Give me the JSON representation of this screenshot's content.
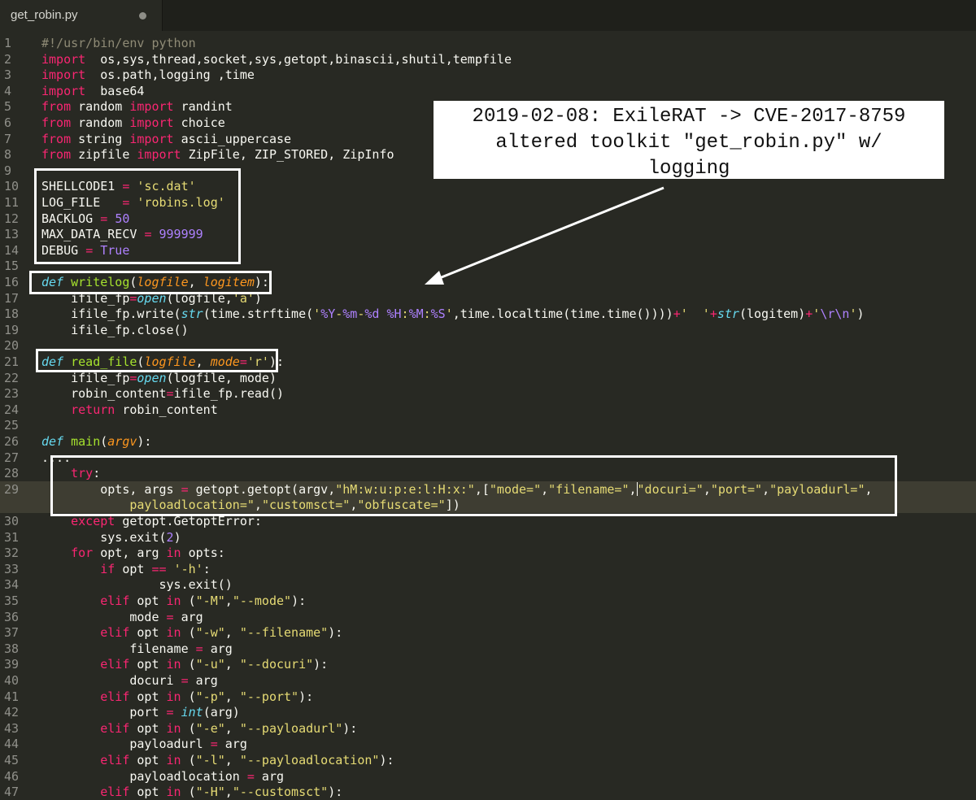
{
  "tab": {
    "title": "get_robin.py"
  },
  "callout": {
    "line1": "2019-02-08: ExileRAT -> CVE-2017-8759",
    "line2": "altered toolkit \"get_robin.py\" w/",
    "line3": "logging"
  },
  "lines": [
    {
      "n": "1",
      "t": [
        [
          "c",
          "#!/usr/bin/env python"
        ]
      ]
    },
    {
      "n": "2",
      "t": [
        [
          "k",
          "import"
        ],
        [
          "",
          "  os,sys,thread,socket,sys,getopt,binascii,shutil,tempfile"
        ]
      ]
    },
    {
      "n": "3",
      "t": [
        [
          "k",
          "import"
        ],
        [
          "",
          "  os.path,logging ,time"
        ]
      ]
    },
    {
      "n": "4",
      "t": [
        [
          "k",
          "import"
        ],
        [
          "",
          "  base64"
        ]
      ]
    },
    {
      "n": "5",
      "t": [
        [
          "k",
          "from"
        ],
        [
          "",
          " random "
        ],
        [
          "k",
          "import"
        ],
        [
          "",
          " randint"
        ]
      ]
    },
    {
      "n": "6",
      "t": [
        [
          "k",
          "from"
        ],
        [
          "",
          " random "
        ],
        [
          "k",
          "import"
        ],
        [
          "",
          " choice"
        ]
      ]
    },
    {
      "n": "7",
      "t": [
        [
          "k",
          "from"
        ],
        [
          "",
          " string "
        ],
        [
          "k",
          "import"
        ],
        [
          "",
          " ascii_uppercase"
        ]
      ]
    },
    {
      "n": "8",
      "t": [
        [
          "k",
          "from"
        ],
        [
          "",
          " zipfile "
        ],
        [
          "k",
          "import"
        ],
        [
          "",
          " ZipFile, ZIP_STORED, ZipInfo"
        ]
      ]
    },
    {
      "n": "9",
      "t": []
    },
    {
      "n": "10",
      "t": [
        [
          "",
          "SHELLCODE1 "
        ],
        [
          "k",
          "="
        ],
        [
          "",
          " "
        ],
        [
          "s",
          "'sc.dat'"
        ]
      ]
    },
    {
      "n": "11",
      "t": [
        [
          "",
          "LOG_FILE   "
        ],
        [
          "k",
          "="
        ],
        [
          "",
          " "
        ],
        [
          "s",
          "'robins.log'"
        ]
      ]
    },
    {
      "n": "12",
      "t": [
        [
          "",
          "BACKLOG "
        ],
        [
          "k",
          "="
        ],
        [
          "",
          " "
        ],
        [
          "n",
          "50"
        ]
      ]
    },
    {
      "n": "13",
      "t": [
        [
          "",
          "MAX_DATA_RECV "
        ],
        [
          "k",
          "="
        ],
        [
          "",
          " "
        ],
        [
          "n",
          "999999"
        ]
      ]
    },
    {
      "n": "14",
      "t": [
        [
          "",
          "DEBUG "
        ],
        [
          "k",
          "="
        ],
        [
          "",
          " "
        ],
        [
          "n",
          "True"
        ]
      ]
    },
    {
      "n": "15",
      "t": []
    },
    {
      "n": "16",
      "t": [
        [
          "d",
          "def"
        ],
        [
          "",
          " "
        ],
        [
          "f",
          "writelog"
        ],
        [
          "",
          "("
        ],
        [
          "p",
          "logfile"
        ],
        [
          "",
          ", "
        ],
        [
          "p",
          "logitem"
        ],
        [
          "",
          "):"
        ]
      ]
    },
    {
      "n": "17",
      "t": [
        [
          "",
          "    ifile_fp"
        ],
        [
          "k",
          "="
        ],
        [
          "b",
          "open"
        ],
        [
          "",
          "(logfile,"
        ],
        [
          "s",
          "'a'"
        ],
        [
          "",
          ")"
        ]
      ]
    },
    {
      "n": "18",
      "t": [
        [
          "",
          "    ifile_fp.write("
        ],
        [
          "b",
          "str"
        ],
        [
          "",
          "(time.strftime("
        ],
        [
          "s",
          "'"
        ],
        [
          "n",
          "%Y"
        ],
        [
          "s",
          "-"
        ],
        [
          "n",
          "%m"
        ],
        [
          "s",
          "-"
        ],
        [
          "n",
          "%d"
        ],
        [
          "s",
          " "
        ],
        [
          "n",
          "%H"
        ],
        [
          "s",
          ":"
        ],
        [
          "n",
          "%M"
        ],
        [
          "s",
          ":"
        ],
        [
          "n",
          "%S"
        ],
        [
          "s",
          "'"
        ],
        [
          "",
          ",time.localtime(time.time())))"
        ],
        [
          "k",
          "+"
        ],
        [
          "s",
          "'  '"
        ],
        [
          "k",
          "+"
        ],
        [
          "b",
          "str"
        ],
        [
          "",
          "(logitem)"
        ],
        [
          "k",
          "+"
        ],
        [
          "s",
          "'"
        ],
        [
          "n",
          "\\r\\n"
        ],
        [
          "s",
          "'"
        ],
        [
          "",
          ")"
        ]
      ]
    },
    {
      "n": "19",
      "t": [
        [
          "",
          "    ifile_fp.close()"
        ]
      ]
    },
    {
      "n": "20",
      "t": []
    },
    {
      "n": "21",
      "t": [
        [
          "d",
          "def"
        ],
        [
          "",
          " "
        ],
        [
          "f",
          "read_file"
        ],
        [
          "",
          "("
        ],
        [
          "p",
          "logfile"
        ],
        [
          "",
          ", "
        ],
        [
          "p",
          "mode"
        ],
        [
          "k",
          "="
        ],
        [
          "s",
          "'r'"
        ],
        [
          "",
          "):"
        ]
      ]
    },
    {
      "n": "22",
      "t": [
        [
          "",
          "    ifile_fp"
        ],
        [
          "k",
          "="
        ],
        [
          "b",
          "open"
        ],
        [
          "",
          "(logfile, mode)"
        ]
      ]
    },
    {
      "n": "23",
      "t": [
        [
          "",
          "    robin_content"
        ],
        [
          "k",
          "="
        ],
        [
          "",
          "ifile_fp.read()"
        ]
      ]
    },
    {
      "n": "24",
      "t": [
        [
          "",
          "    "
        ],
        [
          "k",
          "return"
        ],
        [
          "",
          " robin_content"
        ]
      ]
    },
    {
      "n": "25",
      "t": []
    },
    {
      "n": "26",
      "t": [
        [
          "d",
          "def"
        ],
        [
          "",
          " "
        ],
        [
          "f",
          "main"
        ],
        [
          "",
          "("
        ],
        [
          "p",
          "argv"
        ],
        [
          "",
          "):"
        ]
      ]
    },
    {
      "n": "27",
      "t": [
        [
          "",
          "...."
        ]
      ]
    },
    {
      "n": "28",
      "t": [
        [
          "",
          "    "
        ],
        [
          "k",
          "try"
        ],
        [
          "",
          ":"
        ]
      ]
    },
    {
      "n": "29",
      "t": [
        [
          "",
          "        opts, args "
        ],
        [
          "k",
          "="
        ],
        [
          "",
          " getopt.getopt(argv,"
        ],
        [
          "s",
          "\"hM:w:u:p:e:l:H:x:\""
        ],
        [
          "",
          ",["
        ],
        [
          "s",
          "\"mode=\""
        ],
        [
          "",
          ","
        ],
        [
          "s",
          "\"filename=\""
        ],
        [
          "",
          ","
        ],
        [
          "cur",
          ""
        ],
        [
          "s",
          "\"docuri=\""
        ],
        [
          "",
          ","
        ],
        [
          "s",
          "\"port=\""
        ],
        [
          "",
          ","
        ],
        [
          "s",
          "\"payloadurl=\""
        ],
        [
          "",
          ","
        ]
      ]
    },
    {
      "n": "",
      "t": [
        [
          "",
          "            "
        ],
        [
          "s",
          "payloadlocation=\""
        ],
        [
          "",
          ","
        ],
        [
          "s",
          "\"customsct=\""
        ],
        [
          "",
          ","
        ],
        [
          "s",
          "\"obfuscate=\""
        ],
        [
          "",
          "])"
        ]
      ]
    },
    {
      "n": "30",
      "t": [
        [
          "",
          "    "
        ],
        [
          "k",
          "except"
        ],
        [
          "",
          " getopt.GetoptError:"
        ]
      ]
    },
    {
      "n": "31",
      "t": [
        [
          "",
          "        sys.exit("
        ],
        [
          "n",
          "2"
        ],
        [
          "",
          ")"
        ]
      ]
    },
    {
      "n": "32",
      "t": [
        [
          "",
          "    "
        ],
        [
          "k",
          "for"
        ],
        [
          "",
          " opt, arg "
        ],
        [
          "k",
          "in"
        ],
        [
          "",
          " opts:"
        ]
      ]
    },
    {
      "n": "33",
      "t": [
        [
          "",
          "        "
        ],
        [
          "k",
          "if"
        ],
        [
          "",
          " opt "
        ],
        [
          "k",
          "=="
        ],
        [
          "",
          " "
        ],
        [
          "s",
          "'-h'"
        ],
        [
          "",
          ":"
        ]
      ]
    },
    {
      "n": "34",
      "t": [
        [
          "",
          "                sys.exit()"
        ]
      ]
    },
    {
      "n": "35",
      "t": [
        [
          "",
          "        "
        ],
        [
          "k",
          "elif"
        ],
        [
          "",
          " opt "
        ],
        [
          "k",
          "in"
        ],
        [
          "",
          " ("
        ],
        [
          "s",
          "\"-M\""
        ],
        [
          "",
          ","
        ],
        [
          "s",
          "\"--mode\""
        ],
        [
          "",
          "):"
        ]
      ]
    },
    {
      "n": "36",
      "t": [
        [
          "",
          "            mode "
        ],
        [
          "k",
          "="
        ],
        [
          "",
          " arg"
        ]
      ]
    },
    {
      "n": "37",
      "t": [
        [
          "",
          "        "
        ],
        [
          "k",
          "elif"
        ],
        [
          "",
          " opt "
        ],
        [
          "k",
          "in"
        ],
        [
          "",
          " ("
        ],
        [
          "s",
          "\"-w\""
        ],
        [
          "",
          ", "
        ],
        [
          "s",
          "\"--filename\""
        ],
        [
          "",
          "):"
        ]
      ]
    },
    {
      "n": "38",
      "t": [
        [
          "",
          "            filename "
        ],
        [
          "k",
          "="
        ],
        [
          "",
          " arg"
        ]
      ]
    },
    {
      "n": "39",
      "t": [
        [
          "",
          "        "
        ],
        [
          "k",
          "elif"
        ],
        [
          "",
          " opt "
        ],
        [
          "k",
          "in"
        ],
        [
          "",
          " ("
        ],
        [
          "s",
          "\"-u\""
        ],
        [
          "",
          ", "
        ],
        [
          "s",
          "\"--docuri\""
        ],
        [
          "",
          "):"
        ]
      ]
    },
    {
      "n": "40",
      "t": [
        [
          "",
          "            docuri "
        ],
        [
          "k",
          "="
        ],
        [
          "",
          " arg"
        ]
      ]
    },
    {
      "n": "41",
      "t": [
        [
          "",
          "        "
        ],
        [
          "k",
          "elif"
        ],
        [
          "",
          " opt "
        ],
        [
          "k",
          "in"
        ],
        [
          "",
          " ("
        ],
        [
          "s",
          "\"-p\""
        ],
        [
          "",
          ", "
        ],
        [
          "s",
          "\"--port\""
        ],
        [
          "",
          "):"
        ]
      ]
    },
    {
      "n": "42",
      "t": [
        [
          "",
          "            port "
        ],
        [
          "k",
          "="
        ],
        [
          "",
          " "
        ],
        [
          "b",
          "int"
        ],
        [
          "",
          "(arg)"
        ]
      ]
    },
    {
      "n": "43",
      "t": [
        [
          "",
          "        "
        ],
        [
          "k",
          "elif"
        ],
        [
          "",
          " opt "
        ],
        [
          "k",
          "in"
        ],
        [
          "",
          " ("
        ],
        [
          "s",
          "\"-e\""
        ],
        [
          "",
          ", "
        ],
        [
          "s",
          "\"--payloadurl\""
        ],
        [
          "",
          "):"
        ]
      ]
    },
    {
      "n": "44",
      "t": [
        [
          "",
          "            payloadurl "
        ],
        [
          "k",
          "="
        ],
        [
          "",
          " arg"
        ]
      ]
    },
    {
      "n": "45",
      "t": [
        [
          "",
          "        "
        ],
        [
          "k",
          "elif"
        ],
        [
          "",
          " opt "
        ],
        [
          "k",
          "in"
        ],
        [
          "",
          " ("
        ],
        [
          "s",
          "\"-l\""
        ],
        [
          "",
          ", "
        ],
        [
          "s",
          "\"--payloadlocation\""
        ],
        [
          "",
          "):"
        ]
      ]
    },
    {
      "n": "46",
      "t": [
        [
          "",
          "            payloadlocation "
        ],
        [
          "k",
          "="
        ],
        [
          "",
          " arg"
        ]
      ]
    },
    {
      "n": "47",
      "t": [
        [
          "",
          "        "
        ],
        [
          "k",
          "elif"
        ],
        [
          "",
          " opt "
        ],
        [
          "k",
          "in"
        ],
        [
          "",
          " ("
        ],
        [
          "s",
          "\"-H\""
        ],
        [
          "",
          ","
        ],
        [
          "s",
          "\"--customsct\""
        ],
        [
          "",
          "):"
        ]
      ]
    }
  ]
}
